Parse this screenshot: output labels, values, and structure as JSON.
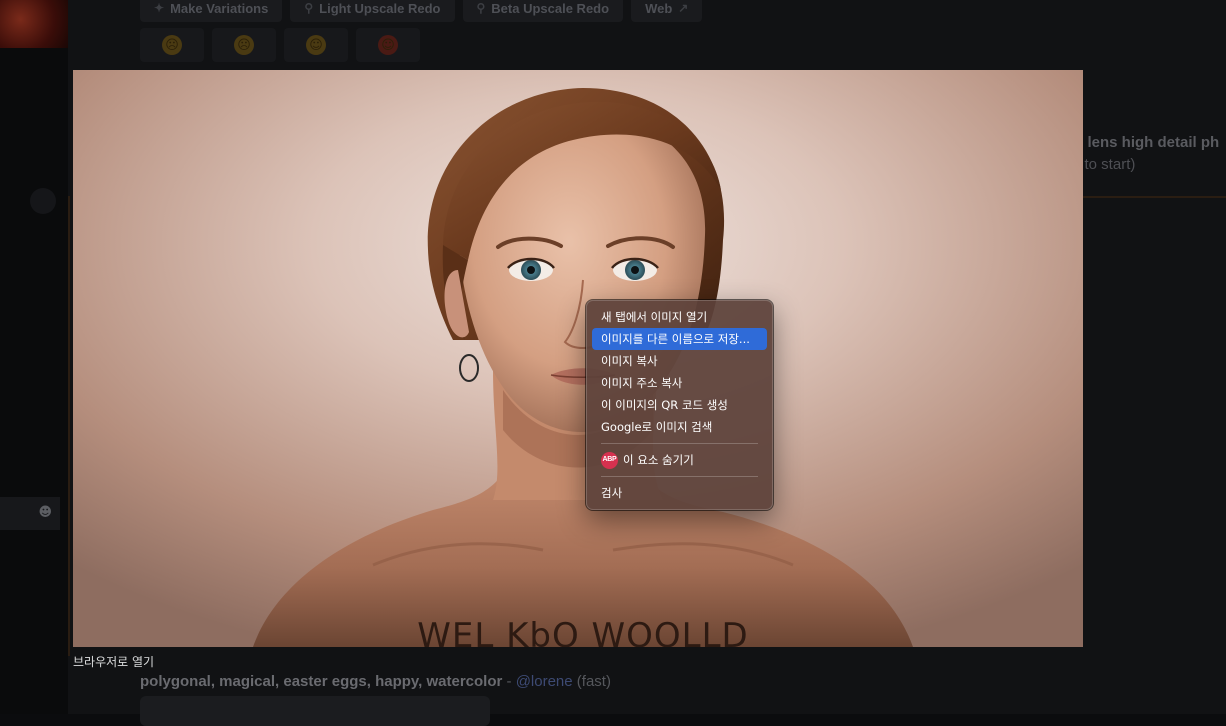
{
  "background": {
    "action_buttons": [
      {
        "label": "Make Variations",
        "icon": "magic-wand-icon"
      },
      {
        "label": "Light Upscale Redo",
        "icon": "magnifier-icon"
      },
      {
        "label": "Beta Upscale Redo",
        "icon": "magnifier-icon"
      },
      {
        "label": "Web",
        "icon": "external-link-icon"
      }
    ],
    "reaction_buttons": [
      {
        "icon": "frown-face-icon"
      },
      {
        "icon": "neutral-face-icon"
      },
      {
        "icon": "smile-face-icon"
      },
      {
        "icon": "heart-eyes-face-icon"
      }
    ],
    "partial_prompt": "m lens high detail ph",
    "partial_status": "g to start)",
    "bottom_prompt": {
      "text": "polygonal, magical, easter eggs, happy, watercolor",
      "dash": " - ",
      "user": "@lorene",
      "speed": " (fast)"
    }
  },
  "image_viewer": {
    "embedded_text": "WEL KbO WOOLLD",
    "open_in_browser_label": "브라우저로 열기"
  },
  "context_menu": {
    "items": [
      {
        "label": "새 탭에서 이미지 열기",
        "selected": false
      },
      {
        "label": "이미지를 다른 이름으로 저장...",
        "selected": true
      },
      {
        "label": "이미지 복사",
        "selected": false
      },
      {
        "label": "이미지 주소 복사",
        "selected": false
      },
      {
        "label": "이 이미지의 QR 코드 생성",
        "selected": false
      },
      {
        "label": "Google로 이미지 검색",
        "selected": false
      }
    ],
    "adblock_item": {
      "label": "이 요소 숨기기",
      "badge": "ABP"
    },
    "inspect_item": {
      "label": "검사"
    },
    "colors": {
      "highlight": "#2f6bd8",
      "abp_badge": "#d6314f"
    }
  }
}
